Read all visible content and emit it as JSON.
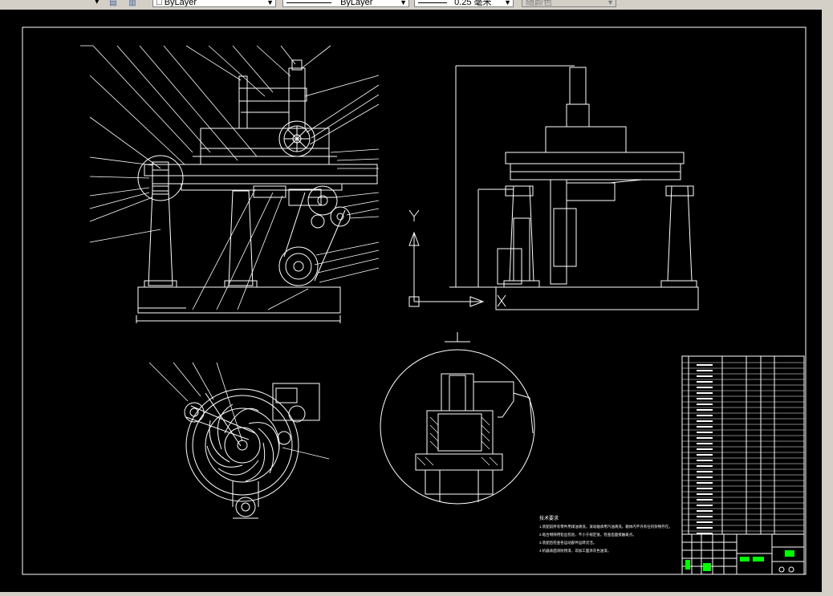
{
  "toolbar": {
    "layer_combo": "□ ByLayer",
    "linetype_combo": "ByLayer",
    "lineweight_combo": "0.25 毫米",
    "plotstyle_combo": "随颜色"
  },
  "drawing": {
    "background": "#000000",
    "line_color": "#ffffff",
    "accent_green": "#00ff00",
    "ucs_icon_label": "Y",
    "notes_title": "技术要求",
    "notes": [
      "1.装配前所有零件用煤油清洗，滚动轴承用汽油清洗，箱体内不许有任何杂物存在。",
      "2.啮合侧隙用铅丝检验，不小于规定值，检查齿面接触斑点。",
      "3.装配后检查各运动部件运转灵活。",
      "4.机器表面涂防锈漆，非加工面涂灰色油漆。"
    ]
  }
}
